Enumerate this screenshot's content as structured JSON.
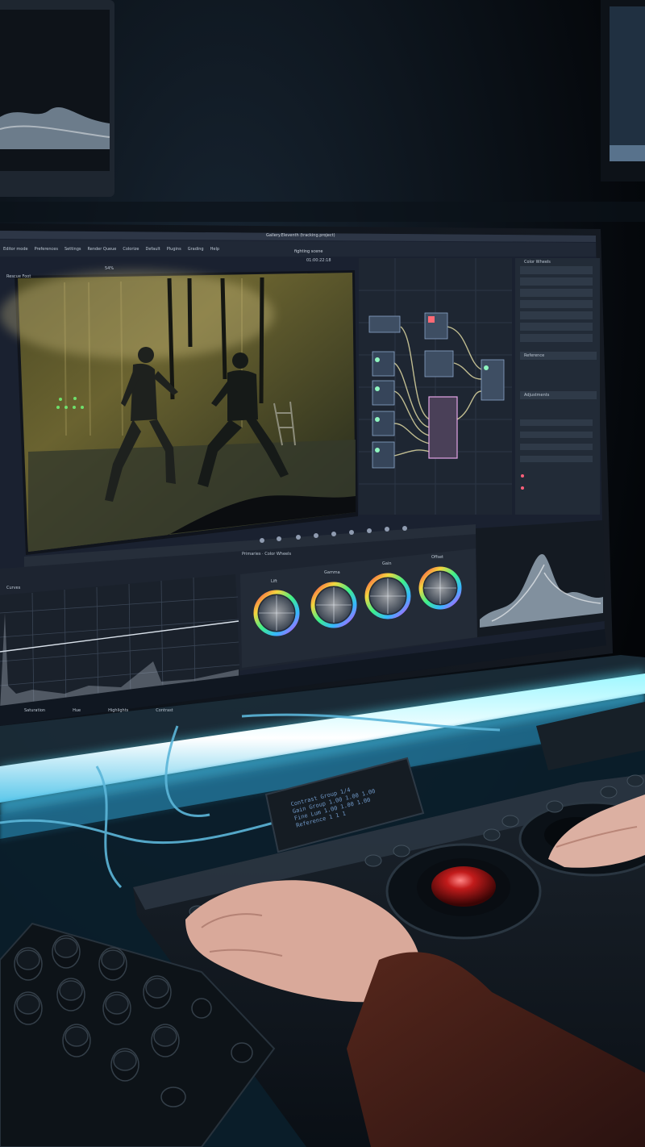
{
  "scene": {
    "description_labels": {
      "monitor": "color grading workstation monitor",
      "panel": "color grading control surface"
    }
  },
  "app": {
    "title": "Gallery.Eleventh (tracking.project)",
    "project_name": "fighting scene",
    "menu": [
      "Editor mode",
      "Preferences",
      "Settings",
      "Render Queue",
      "Colorize",
      "Default",
      "Plugins",
      "Grading",
      "Help"
    ],
    "viewer_label": "Rescue Foot",
    "timecode": "01:00:22:18",
    "zoom": "54%",
    "right_panel_labels": [
      "Reference",
      "Adjustments",
      "Color Wheels"
    ],
    "sections": {
      "primaries": "Primaries · Color Wheels",
      "wheels": [
        "Lift",
        "Gamma",
        "Gain",
        "Offset"
      ]
    },
    "curves_label": "Curves",
    "bottom_labels": [
      "Saturation",
      "Hue",
      "Highlights",
      "Contrast"
    ]
  },
  "console_display": {
    "lines": [
      "Contrast Group 1/4",
      "Gain Group  1.00  1.00  1.00",
      "Fine Lum  1.00  1.00  1.00",
      "Reference  1  1  1"
    ]
  },
  "colors": {
    "glow": "#59e9ff",
    "ui_bg": "#1b2230",
    "accent": "#7ea3d8"
  }
}
